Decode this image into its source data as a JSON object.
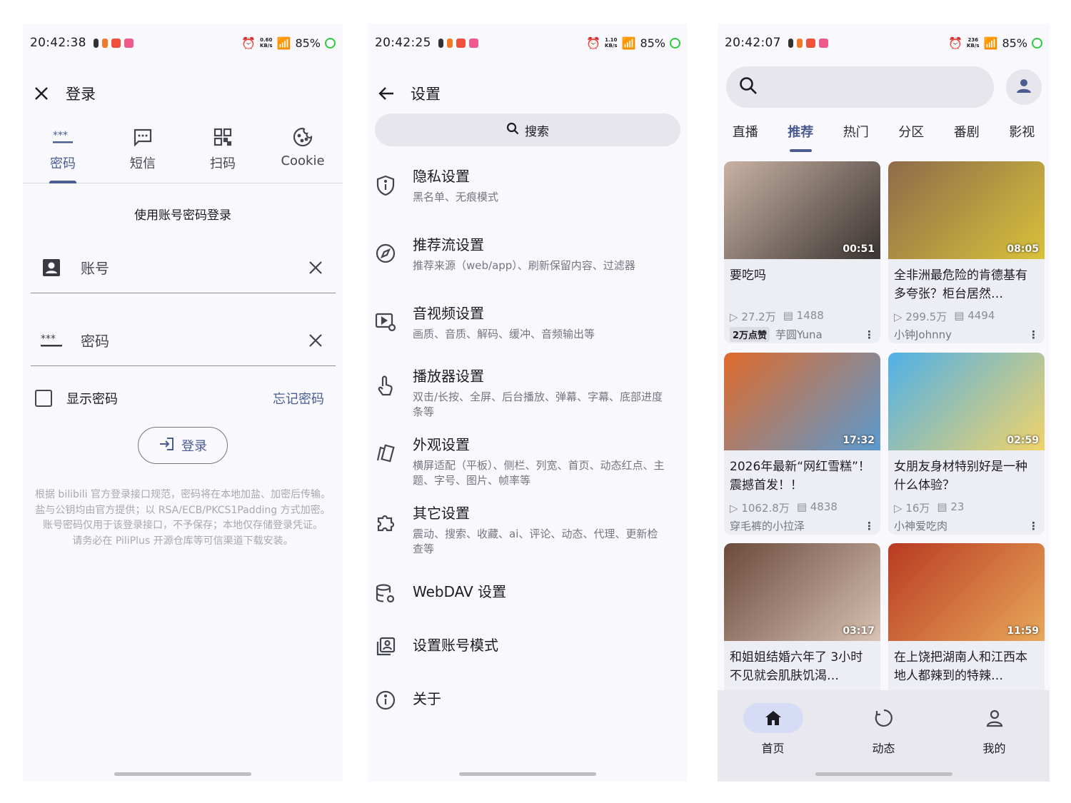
{
  "status": {
    "p1": {
      "time": "20:42:38",
      "speed_top": "0.60",
      "speed_unit": "KB/s",
      "battery": "85%"
    },
    "p2": {
      "time": "20:42:25",
      "speed_top": "1.10",
      "speed_unit": "KB/s",
      "battery": "85%"
    },
    "p3": {
      "time": "20:42:07",
      "speed_top": "236",
      "speed_unit": "KB/s",
      "battery": "85%"
    }
  },
  "login": {
    "title": "登录",
    "tabs": [
      "密码",
      "短信",
      "扫码",
      "Cookie"
    ],
    "subtitle": "使用账号密码登录",
    "account_placeholder": "账号",
    "password_placeholder": "密码",
    "show_password": "显示密码",
    "forgot": "忘记密码",
    "login_button": "登录",
    "notes": [
      "根据 bilibili 官方登录接口规范，密码将在本地加盐、加密后传输。",
      "盐与公钥均由官方提供；以 RSA/ECB/PKCS1Padding 方式加密。",
      "账号密码仅用于该登录接口，不予保存；本地仅存储登录凭证。",
      "请务必在 PiliPlus 开源仓库等可信渠道下载安装。"
    ]
  },
  "settings": {
    "title": "设置",
    "search": "搜索",
    "items": [
      {
        "title": "隐私设置",
        "subtitle": "黑名单、无痕模式"
      },
      {
        "title": "推荐流设置",
        "subtitle": "推荐来源（web/app）、刷新保留内容、过滤器"
      },
      {
        "title": "音视频设置",
        "subtitle": "画质、音质、解码、缓冲、音频输出等"
      },
      {
        "title": "播放器设置",
        "subtitle": "双击/长按、全屏、后台播放、弹幕、字幕、底部进度条等"
      },
      {
        "title": "外观设置",
        "subtitle": "横屏适配（平板）、侧栏、列宽、首页、动态红点、主题、字号、图片、帧率等"
      },
      {
        "title": "其它设置",
        "subtitle": "震动、搜索、收藏、ai、评论、动态、代理、更新检查等"
      },
      {
        "title": "WebDAV 设置",
        "subtitle": ""
      },
      {
        "title": "设置账号模式",
        "subtitle": ""
      },
      {
        "title": "关于",
        "subtitle": ""
      }
    ]
  },
  "home": {
    "tabs": [
      "直播",
      "推荐",
      "热门",
      "分区",
      "番剧",
      "影视"
    ],
    "active_tab": "推荐",
    "videos": [
      {
        "title": "要吃吗",
        "duration": "00:51",
        "views": "27.2万",
        "danmaku": "1488",
        "badge": "2万点赞",
        "author": "芋圆Yuna",
        "thumb": [
          "#c9b2a4",
          "#3a3432"
        ]
      },
      {
        "title": "全非洲最危险的肯德基有多夸张？柜台居然…",
        "duration": "08:05",
        "views": "299.5万",
        "danmaku": "4494",
        "badge": "",
        "author": "小钟Johnny",
        "thumb": [
          "#8d6b4a",
          "#d8c23a"
        ]
      },
      {
        "title": "2026年最新“网红雪糕”！震撼首发！！",
        "duration": "17:32",
        "views": "1062.8万",
        "danmaku": "4838",
        "badge": "",
        "author": "穿毛裤的小拉泽",
        "thumb": [
          "#e06a2a",
          "#5a9ad0"
        ]
      },
      {
        "title": "女朋友身材特别好是一种什么体验？",
        "duration": "02:59",
        "views": "16万",
        "danmaku": "23",
        "badge": "",
        "author": "小神爱吃肉",
        "thumb": [
          "#4fb0e8",
          "#f2d36a"
        ]
      },
      {
        "title": "和姐姐结婚六年了 3小时不见就会肌肤饥渴…",
        "duration": "03:17",
        "views": "",
        "danmaku": "",
        "badge": "",
        "author": "",
        "thumb": [
          "#6a4a3c",
          "#d8c2b2"
        ]
      },
      {
        "title": "在上饶把湖南人和江西本地人都辣到的特辣…",
        "duration": "11:59",
        "views": "",
        "danmaku": "",
        "badge": "",
        "author": "",
        "thumb": [
          "#b83a22",
          "#e8a85a"
        ]
      }
    ],
    "nav": [
      "首页",
      "动态",
      "我的"
    ]
  },
  "colors": {
    "accent": "#4a5c92",
    "surface": "#f8f8fd",
    "nav_active": "#d6dcf5"
  }
}
